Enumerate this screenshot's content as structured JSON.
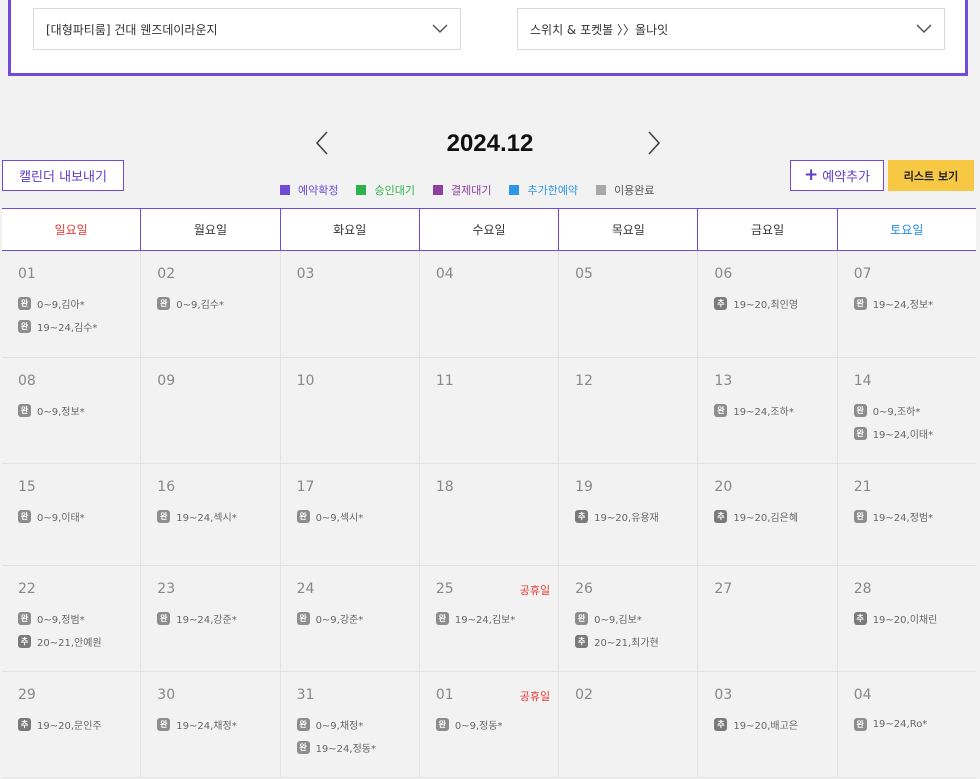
{
  "filters": {
    "room": "[대형파티룸] 건대 웬즈데이라운지",
    "package": "스위치 & 포켓볼 〉〉올나잇"
  },
  "month_title": "2024.12",
  "buttons": {
    "export": "캘린더 내보내기",
    "add_plus": "+",
    "add": "예약추가",
    "list": "리스트 보기"
  },
  "legend": [
    {
      "label": "예약확정",
      "color": "#6f4bd8"
    },
    {
      "label": "승인대기",
      "color": "#2db34a"
    },
    {
      "label": "결제대기",
      "color": "#8e3fa0"
    },
    {
      "label": "추가한예약",
      "color": "#2f96e6"
    },
    {
      "label": "이용완료",
      "color": "#a8a8a8"
    }
  ],
  "weekdays": [
    "일요일",
    "월요일",
    "화요일",
    "수요일",
    "목요일",
    "금요일",
    "토요일"
  ],
  "badges": {
    "done": "완",
    "added": "추"
  },
  "weeks": [
    [
      {
        "day": "01",
        "events": [
          {
            "type": "done",
            "text": "0~9,김아*"
          },
          {
            "type": "done",
            "text": "19~24,김수*"
          }
        ]
      },
      {
        "day": "02",
        "events": [
          {
            "type": "done",
            "text": "0~9,김수*"
          }
        ]
      },
      {
        "day": "03",
        "events": []
      },
      {
        "day": "04",
        "events": []
      },
      {
        "day": "05",
        "events": []
      },
      {
        "day": "06",
        "events": [
          {
            "type": "added",
            "text": "19~20,최인영"
          }
        ]
      },
      {
        "day": "07",
        "events": [
          {
            "type": "done",
            "text": "19~24,정보*"
          }
        ]
      }
    ],
    [
      {
        "day": "08",
        "events": [
          {
            "type": "done",
            "text": "0~9,정보*"
          }
        ]
      },
      {
        "day": "09",
        "events": []
      },
      {
        "day": "10",
        "events": []
      },
      {
        "day": "11",
        "events": []
      },
      {
        "day": "12",
        "events": []
      },
      {
        "day": "13",
        "events": [
          {
            "type": "done",
            "text": "19~24,조하*"
          }
        ]
      },
      {
        "day": "14",
        "events": [
          {
            "type": "done",
            "text": "0~9,조하*"
          },
          {
            "type": "done",
            "text": "19~24,이태*"
          }
        ]
      }
    ],
    [
      {
        "day": "15",
        "events": [
          {
            "type": "done",
            "text": "0~9,이태*"
          }
        ]
      },
      {
        "day": "16",
        "events": [
          {
            "type": "done",
            "text": "19~24,섹시*"
          }
        ]
      },
      {
        "day": "17",
        "events": [
          {
            "type": "done",
            "text": "0~9,섹시*"
          }
        ]
      },
      {
        "day": "18",
        "events": []
      },
      {
        "day": "19",
        "events": [
          {
            "type": "added",
            "text": "19~20,유용재"
          }
        ]
      },
      {
        "day": "20",
        "events": [
          {
            "type": "added",
            "text": "19~20,김은혜"
          }
        ]
      },
      {
        "day": "21",
        "events": [
          {
            "type": "done",
            "text": "19~24,정범*"
          }
        ]
      }
    ],
    [
      {
        "day": "22",
        "events": [
          {
            "type": "done",
            "text": "0~9,정범*"
          },
          {
            "type": "added",
            "text": "20~21,안예원"
          }
        ]
      },
      {
        "day": "23",
        "events": [
          {
            "type": "done",
            "text": "19~24,강준*"
          }
        ]
      },
      {
        "day": "24",
        "events": [
          {
            "type": "done",
            "text": "0~9,강준*"
          }
        ]
      },
      {
        "day": "25",
        "holiday": "공휴일",
        "events": [
          {
            "type": "done",
            "text": "19~24,김보*"
          }
        ]
      },
      {
        "day": "26",
        "events": [
          {
            "type": "done",
            "text": "0~9,김보*"
          },
          {
            "type": "added",
            "text": "20~21,최가현"
          }
        ]
      },
      {
        "day": "27",
        "events": []
      },
      {
        "day": "28",
        "events": [
          {
            "type": "added",
            "text": "19~20,이채린"
          }
        ]
      }
    ],
    [
      {
        "day": "29",
        "events": [
          {
            "type": "added",
            "text": "19~20,문인주"
          }
        ]
      },
      {
        "day": "30",
        "events": [
          {
            "type": "done",
            "text": "19~24,채정*"
          }
        ]
      },
      {
        "day": "31",
        "events": [
          {
            "type": "done",
            "text": "0~9,채정*"
          },
          {
            "type": "done",
            "text": "19~24,정동*"
          }
        ]
      },
      {
        "day": "01",
        "holiday": "공휴일",
        "events": [
          {
            "type": "done",
            "text": "0~9,정동*"
          }
        ]
      },
      {
        "day": "02",
        "events": []
      },
      {
        "day": "03",
        "events": [
          {
            "type": "added",
            "text": "19~20,배고은"
          }
        ]
      },
      {
        "day": "04",
        "events": [
          {
            "type": "done",
            "text": "19~24,Ro*"
          }
        ]
      }
    ]
  ]
}
